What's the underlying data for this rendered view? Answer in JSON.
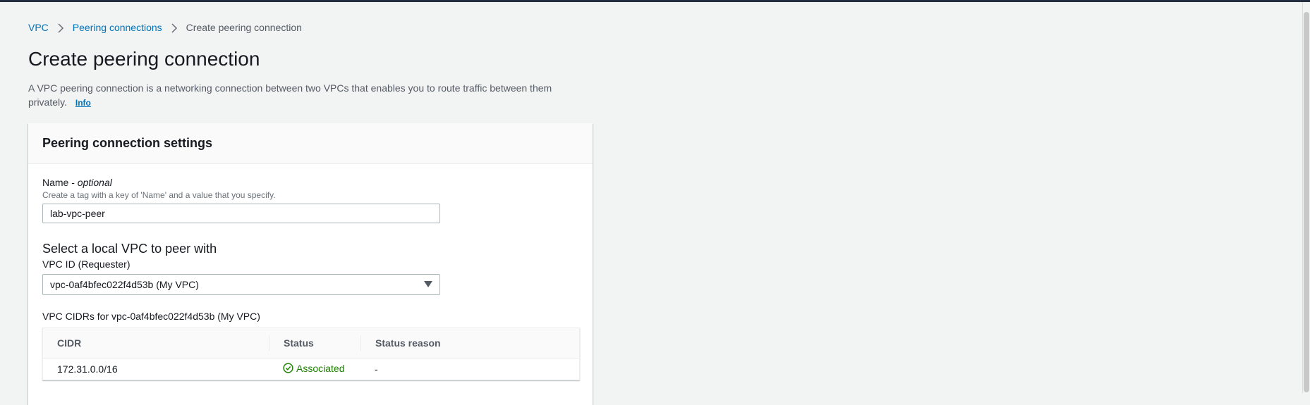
{
  "breadcrumb": {
    "items": [
      "VPC",
      "Peering connections"
    ],
    "current": "Create peering connection"
  },
  "page": {
    "title": "Create peering connection",
    "description": "A VPC peering connection is a networking connection between two VPCs that enables you to route traffic between them privately.",
    "info_link": "Info"
  },
  "panel": {
    "title": "Peering connection settings",
    "name_field": {
      "label": "Name - ",
      "label_optional": "optional",
      "hint": "Create a tag with a key of 'Name' and a value that you specify.",
      "value": "lab-vpc-peer"
    },
    "local_vpc": {
      "section_title": "Select a local VPC to peer with",
      "label": "VPC ID (Requester)",
      "selected": "vpc-0af4bfec022f4d53b (My VPC)"
    },
    "cidrs": {
      "label": "VPC CIDRs for vpc-0af4bfec022f4d53b (My VPC)",
      "columns": [
        "CIDR",
        "Status",
        "Status reason"
      ],
      "rows": [
        {
          "cidr": "172.31.0.0/16",
          "status": "Associated",
          "reason": "-"
        }
      ]
    }
  },
  "colors": {
    "link": "#0073bb",
    "success": "#1d8102",
    "background": "#f2f3f3",
    "top_bar": "#232f3e"
  }
}
